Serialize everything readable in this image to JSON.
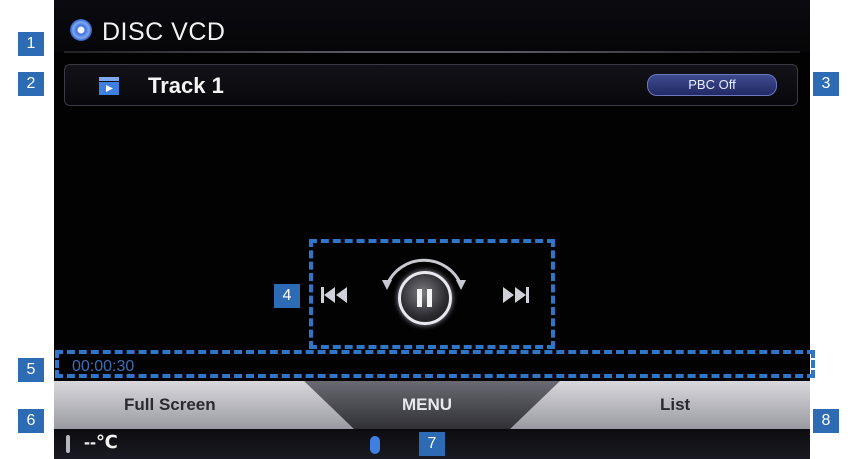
{
  "header": {
    "title": "DISC VCD",
    "icon": "disc-icon"
  },
  "track": {
    "label": "Track 1",
    "icon": "clapper-icon"
  },
  "pbc_button": {
    "label": "PBC Off"
  },
  "playback": {
    "prev_icon": "previous-track-icon",
    "pause_icon": "pause-icon",
    "next_icon": "next-track-icon",
    "time": "00:00:30"
  },
  "tabs": {
    "full_screen": "Full Screen",
    "menu": "MENU",
    "list": "List"
  },
  "status": {
    "temperature": "--℃",
    "bluetooth_icon": "bluetooth-icon",
    "thermometer_icon": "thermometer-icon"
  },
  "callouts": [
    "1",
    "2",
    "3",
    "4",
    "5",
    "6",
    "7",
    "8"
  ],
  "colors": {
    "accent": "#2d6cb5",
    "pbc": "#2a3478",
    "background": "#020203"
  }
}
